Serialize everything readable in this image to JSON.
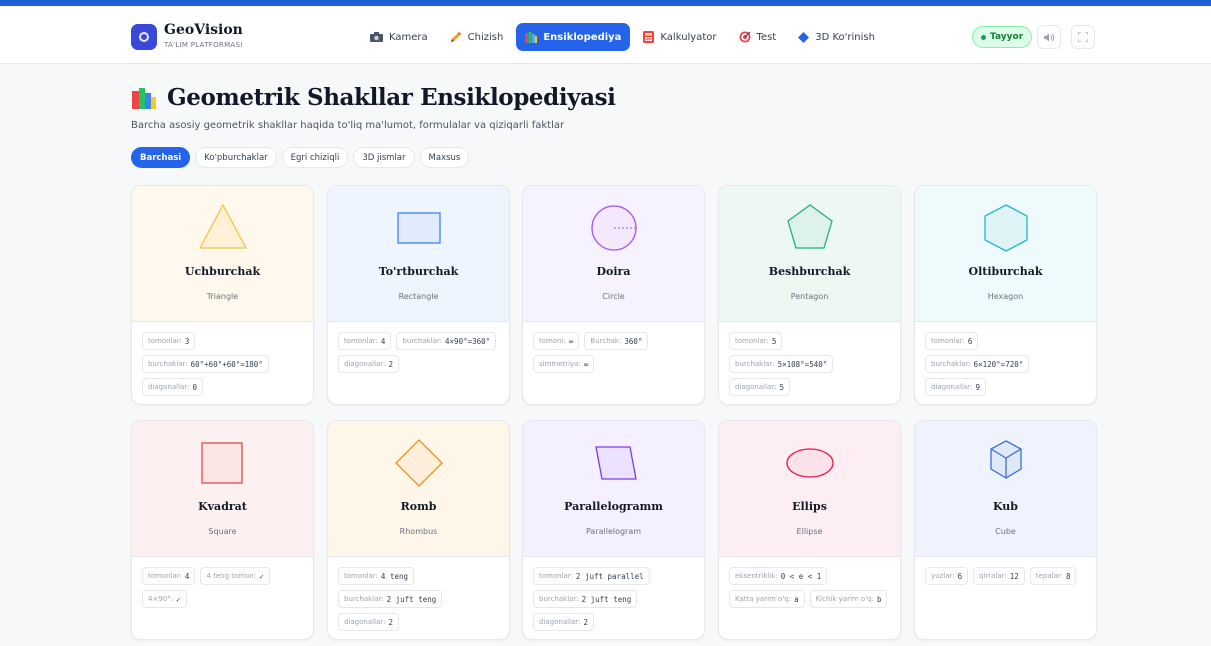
{
  "brand": {
    "name": "GeoVision",
    "subtitle": "TA'LIM PLATFORMASI"
  },
  "nav": [
    {
      "label": "Kamera",
      "icon": "camera-icon"
    },
    {
      "label": "Chizish",
      "icon": "pencil-icon"
    },
    {
      "label": "Ensiklopediya",
      "icon": "books-icon",
      "active": true
    },
    {
      "label": "Kalkulyator",
      "icon": "calculator-icon"
    },
    {
      "label": "Test",
      "icon": "target-icon"
    },
    {
      "label": "3D Ko'rinish",
      "icon": "diamond-icon"
    }
  ],
  "status": "Tayyor",
  "header_buttons": [
    "sound-icon",
    "fullscreen-icon"
  ],
  "page": {
    "icon": "books-icon",
    "title": "Geometrik Shakllar Ensiklopediyasi",
    "subtitle": "Barcha asosiy geometrik shakllar haqida to'liq ma'lumot, formulalar va qiziqarli faktlar"
  },
  "filters": [
    {
      "label": "Barchasi",
      "active": true
    },
    {
      "label": "Ko'pburchaklar"
    },
    {
      "label": "Egri chiziqli"
    },
    {
      "label": "3D jismlar"
    },
    {
      "label": "Maxsus"
    }
  ],
  "cards": [
    {
      "name": "Uchburchak",
      "en": "Triangle",
      "shape": "triangle",
      "color": "#f5c242",
      "bg": "#fff8ec",
      "props": [
        {
          "k": "tomonlar:",
          "v": "3"
        },
        {
          "k": "burchaklar:",
          "v": "60°+60°+60°=180°"
        },
        {
          "k": "diagonallar:",
          "v": "0"
        }
      ]
    },
    {
      "name": "To'rtburchak",
      "en": "Rectangle",
      "shape": "rectangle",
      "color": "#3b82f6",
      "bg": "#eff5ff",
      "props": [
        {
          "k": "tomonlar:",
          "v": "4"
        },
        {
          "k": "burchaklar:",
          "v": "4×90°=360°"
        },
        {
          "k": "diagonallar:",
          "v": "2"
        }
      ]
    },
    {
      "name": "Doira",
      "en": "Circle",
      "shape": "circle",
      "color": "#a855f7",
      "bg": "#f6f2ff",
      "props": [
        {
          "k": "tomoni:",
          "v": "∞"
        },
        {
          "k": "Burchak:",
          "v": "360°"
        },
        {
          "k": "simmetriya:",
          "v": "∞"
        }
      ]
    },
    {
      "name": "Beshburchak",
      "en": "Pentagon",
      "shape": "pentagon",
      "color": "#22b07d",
      "bg": "#edf8f2",
      "props": [
        {
          "k": "tomonlar:",
          "v": "5"
        },
        {
          "k": "burchaklar:",
          "v": "5×108°=540°"
        },
        {
          "k": "diagonallar:",
          "v": "5"
        }
      ]
    },
    {
      "name": "Oltiburchak",
      "en": "Hexagon",
      "shape": "hexagon",
      "color": "#22b8c8",
      "bg": "#eefafb",
      "props": [
        {
          "k": "tomonlar:",
          "v": "6"
        },
        {
          "k": "burchaklar:",
          "v": "6×120°=720°"
        },
        {
          "k": "diagonallar:",
          "v": "9"
        }
      ]
    },
    {
      "name": "Kvadrat",
      "en": "Square",
      "shape": "square",
      "color": "#e24a4a",
      "bg": "#fdf0f0",
      "props": [
        {
          "k": "tomonlar:",
          "v": "4"
        },
        {
          "k": "4 teng tomon:",
          "v": "✓"
        },
        {
          "k": "4×90°:",
          "v": "✓"
        }
      ]
    },
    {
      "name": "Romb",
      "en": "Rhombus",
      "shape": "rhombus",
      "color": "#e8941a",
      "bg": "#fff6ea",
      "props": [
        {
          "k": "tomonlar:",
          "v": "4 teng"
        },
        {
          "k": "burchaklar:",
          "v": "2 juft teng"
        },
        {
          "k": "diagonallar:",
          "v": "2"
        }
      ]
    },
    {
      "name": "Parallelogramm",
      "en": "Parallelogram",
      "shape": "parallelogram",
      "color": "#7c3aed",
      "bg": "#f4f0ff",
      "props": [
        {
          "k": "tomonlar:",
          "v": "2 juft parallel"
        },
        {
          "k": "burchaklar:",
          "v": "2 juft teng"
        },
        {
          "k": "diagonallar:",
          "v": "2"
        }
      ]
    },
    {
      "name": "Ellips",
      "en": "Ellipse",
      "shape": "ellipse",
      "color": "#e11d48",
      "bg": "#fdeef3",
      "props": [
        {
          "k": "eksentriklik:",
          "v": "0 < e < 1"
        },
        {
          "k": "Katta yarim o'q:",
          "v": "a"
        },
        {
          "k": "Kichik yarim o'q:",
          "v": "b"
        }
      ]
    },
    {
      "name": "Kub",
      "en": "Cube",
      "shape": "cube",
      "color": "#3b6fd9",
      "bg": "#eef3fd",
      "props": [
        {
          "k": "yuzlar:",
          "v": "6"
        },
        {
          "k": "qirralar:",
          "v": "12"
        },
        {
          "k": "tepalar:",
          "v": "8"
        }
      ]
    }
  ]
}
